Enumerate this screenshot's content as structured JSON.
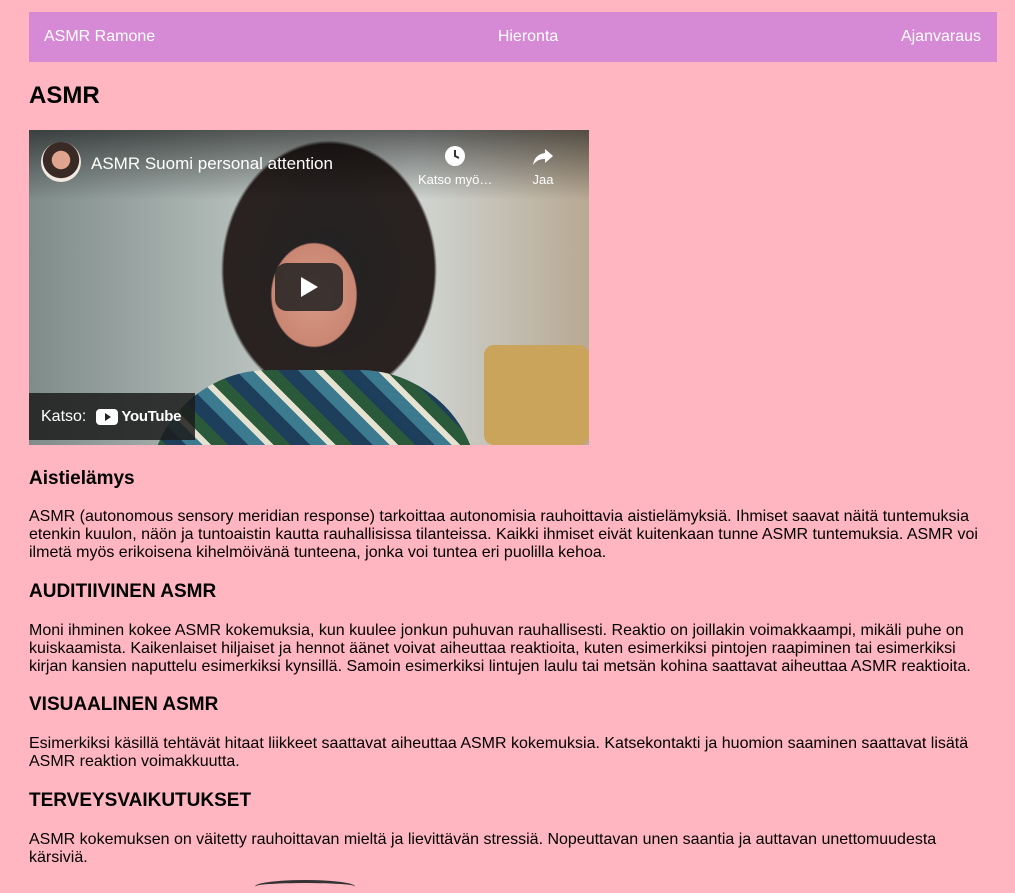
{
  "nav": {
    "brand": "ASMR Ramone",
    "massage": "Hieronta",
    "booking": "Ajanvaraus"
  },
  "page_title": "ASMR",
  "video": {
    "title": "ASMR Suomi personal attention",
    "watch_later": "Katso myö…",
    "share": "Jaa",
    "watch_on": "Katso:",
    "youtube": "YouTube"
  },
  "sections": [
    {
      "heading": "Aistielämys",
      "text": "ASMR (autonomous sensory meridian response) tarkoittaa autonomisia rauhoittavia aistielämyksiä. Ihmiset saavat näitä tuntemuksia etenkin kuulon, näön ja tuntoaistin kautta rauhallisissa tilanteissa. Kaikki ihmiset eivät kuitenkaan tunne ASMR tuntemuksia. ASMR voi ilmetä myös erikoisena kihelmöivänä tunteena, jonka voi tuntea eri puolilla kehoa."
    },
    {
      "heading": "AUDITIIVINEN ASMR",
      "text": "Moni ihminen kokee ASMR kokemuksia, kun kuulee jonkun puhuvan rauhallisesti. Reaktio on joillakin voimakkaampi, mikäli puhe on kuiskaamista. Kaikenlaiset hiljaiset ja hennot äänet voivat aiheuttaa reaktioita, kuten esimerkiksi pintojen raapiminen tai esimerkiksi kirjan kansien naputtelu esimerkiksi kynsillä. Samoin esimerkiksi lintujen laulu tai metsän kohina saattavat aiheuttaa ASMR reaktioita."
    },
    {
      "heading": "VISUAALINEN ASMR",
      "text": "Esimerkiksi käsillä tehtävät hitaat liikkeet saattavat aiheuttaa ASMR kokemuksia. Katsekontakti ja huomion saaminen saattavat lisätä ASMR reaktion voimakkuutta."
    },
    {
      "heading": "TERVEYSVAIKUTUKSET",
      "text": "ASMR kokemuksen on väitetty rauhoittavan mieltä ja lievittävän stressiä. Nopeuttavan unen saantia ja auttavan unettomuudesta kärsiviä."
    }
  ],
  "colors": {
    "background": "#ffb6c1",
    "nav_background": "#d68ad6",
    "nav_text": "#ffffff"
  }
}
